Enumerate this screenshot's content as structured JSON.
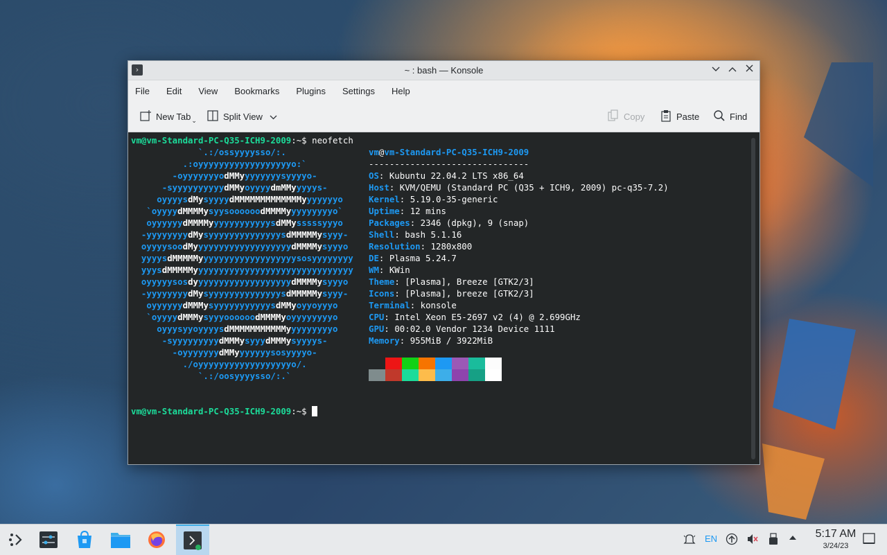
{
  "window": {
    "title": "~ : bash — Konsole"
  },
  "menubar": [
    "File",
    "Edit",
    "View",
    "Bookmarks",
    "Plugins",
    "Settings",
    "Help"
  ],
  "toolbar": {
    "new_tab": "New Tab",
    "split_view": "Split View",
    "copy": "Copy",
    "paste": "Paste",
    "find": "Find"
  },
  "terminal": {
    "prompt": "vm@vm-Standard-PC-Q35-ICH9-2009",
    "prompt_suffix": ":~$ ",
    "command": "neofetch",
    "header_user": "vm",
    "header_at": "@",
    "header_host": "vm-Standard-PC-Q35-ICH9-2009",
    "separator": "-------------------------------",
    "info": [
      {
        "key": "OS",
        "value": "Kubuntu 22.04.2 LTS x86_64"
      },
      {
        "key": "Host",
        "value": "KVM/QEMU (Standard PC (Q35 + ICH9, 2009) pc-q35-7.2)"
      },
      {
        "key": "Kernel",
        "value": "5.19.0-35-generic"
      },
      {
        "key": "Uptime",
        "value": "12 mins"
      },
      {
        "key": "Packages",
        "value": "2346 (dpkg), 9 (snap)"
      },
      {
        "key": "Shell",
        "value": "bash 5.1.16"
      },
      {
        "key": "Resolution",
        "value": "1280x800"
      },
      {
        "key": "DE",
        "value": "Plasma 5.24.7"
      },
      {
        "key": "WM",
        "value": "KWin"
      },
      {
        "key": "Theme",
        "value": "[Plasma], Breeze [GTK2/3]"
      },
      {
        "key": "Icons",
        "value": "[Plasma], breeze [GTK2/3]"
      },
      {
        "key": "Terminal",
        "value": "konsole"
      },
      {
        "key": "CPU",
        "value": "Intel Xeon E5-2697 v2 (4) @ 2.699GHz"
      },
      {
        "key": "GPU",
        "value": "00:02.0 Vendor 1234 Device 1111"
      },
      {
        "key": "Memory",
        "value": "955MiB / 3922MiB"
      }
    ],
    "logo": [
      [
        [
          "b",
          "             `.:/ossyyyysso/:."
        ]
      ],
      [
        [
          "b",
          "          .:oyyyyyyyyyyyyyyyyyyo:`"
        ]
      ],
      [
        [
          "b",
          "        -oyyyyyyyo"
        ],
        [
          "w",
          "dMMy"
        ],
        [
          "b",
          "yyyyyyysyyyyo-"
        ]
      ],
      [
        [
          "b",
          "      -syyyyyyyyyy"
        ],
        [
          "w",
          "dMMy"
        ],
        [
          "b",
          "oyyyy"
        ],
        [
          "w",
          "dmMMy"
        ],
        [
          "b",
          "yyyys-"
        ]
      ],
      [
        [
          "b",
          "     oyyyys"
        ],
        [
          "w",
          "dMy"
        ],
        [
          "b",
          "syyyy"
        ],
        [
          "w",
          "dMMMMMMMMMMMMMy"
        ],
        [
          "b",
          "yyyyyyo"
        ]
      ],
      [
        [
          "b",
          "   `oyyyy"
        ],
        [
          "w",
          "dMMMMy"
        ],
        [
          "b",
          "syysoooooo"
        ],
        [
          "w",
          "dMMMMy"
        ],
        [
          "b",
          "yyyyyyyyo`"
        ]
      ],
      [
        [
          "b",
          "   oyyyyyy"
        ],
        [
          "w",
          "dMMMMy"
        ],
        [
          "b",
          "yyyyyyyyyyys"
        ],
        [
          "w",
          "dMMy"
        ],
        [
          "b",
          "sssssyyyo"
        ]
      ],
      [
        [
          "b",
          "  -yyyyyyyy"
        ],
        [
          "w",
          "dMy"
        ],
        [
          "b",
          "syyyyyyyyyyyyyys"
        ],
        [
          "w",
          "dMMMMMy"
        ],
        [
          "b",
          "syyy-"
        ]
      ],
      [
        [
          "b",
          "  oyyyysoo"
        ],
        [
          "w",
          "dMy"
        ],
        [
          "b",
          "yyyyyyyyyyyyyyyyyy"
        ],
        [
          "w",
          "dMMMMy"
        ],
        [
          "b",
          "syyyo"
        ]
      ],
      [
        [
          "b",
          "  yyyys"
        ],
        [
          "w",
          "dMMMMMy"
        ],
        [
          "b",
          "yyyyyyyyyyyyyyyyyysosyyyyyyyy"
        ]
      ],
      [
        [
          "b",
          "  yyys"
        ],
        [
          "w",
          "dMMMMMy"
        ],
        [
          "b",
          "yyyyyyyyyyyyyyyyyyyyyyyyyyyyyy"
        ]
      ],
      [
        [
          "b",
          "  oyyyyysos"
        ],
        [
          "w",
          "dy"
        ],
        [
          "b",
          "yyyyyyyyyyyyyyyyyy"
        ],
        [
          "w",
          "dMMMMy"
        ],
        [
          "b",
          "syyyo"
        ]
      ],
      [
        [
          "b",
          "  -yyyyyyyy"
        ],
        [
          "w",
          "dMy"
        ],
        [
          "b",
          "syyyyyyyyyyyyyys"
        ],
        [
          "w",
          "dMMMMMy"
        ],
        [
          "b",
          "syyy-"
        ]
      ],
      [
        [
          "b",
          "   oyyyyyy"
        ],
        [
          "w",
          "dMMMy"
        ],
        [
          "b",
          "syyyyyyyyyyys"
        ],
        [
          "w",
          "dMMy"
        ],
        [
          "b",
          "oyyoyyyo"
        ]
      ],
      [
        [
          "b",
          "   `oyyyy"
        ],
        [
          "w",
          "dMMMy"
        ],
        [
          "b",
          "syyyoooooo"
        ],
        [
          "w",
          "dMMMMy"
        ],
        [
          "b",
          "oyyyyyyyyo"
        ]
      ],
      [
        [
          "b",
          "     oyyysyyoyyyys"
        ],
        [
          "w",
          "dMMMMMMMMMMMy"
        ],
        [
          "b",
          "yyyyyyyyo"
        ]
      ],
      [
        [
          "b",
          "      -syyyyyyyyy"
        ],
        [
          "w",
          "dMMMy"
        ],
        [
          "b",
          "syyy"
        ],
        [
          "w",
          "dMMMy"
        ],
        [
          "b",
          "syyyys-"
        ]
      ],
      [
        [
          "b",
          "        -oyyyyyyy"
        ],
        [
          "w",
          "dMMy"
        ],
        [
          "b",
          "yyyyyysosyyyyo-"
        ]
      ],
      [
        [
          "b",
          "          ./oyyyyyyyyyyyyyyyyyyo/."
        ]
      ],
      [
        [
          "b",
          "             `.:/oosyyyysso/:.`"
        ]
      ]
    ],
    "palette_top": [
      "#232627",
      "#ed1515",
      "#11d116",
      "#f67400",
      "#1d99f3",
      "#9b59b6",
      "#1abc9c",
      "#fcfcfc"
    ],
    "palette_bottom": [
      "#7f8c8d",
      "#c0392b",
      "#1cdc9a",
      "#fdbc4b",
      "#3daee9",
      "#8e44ad",
      "#16a085",
      "#ffffff"
    ]
  },
  "taskbar": {
    "tray_lang": "EN",
    "time": "5:17 AM",
    "date": "3/24/23",
    "icons": [
      "application-launcher-icon",
      "system-settings-icon",
      "discover-store-icon",
      "file-manager-icon",
      "firefox-icon",
      "konsole-icon"
    ]
  },
  "colors": {
    "terminal_bg": "#232627",
    "prompt_green": "#1cdc9a",
    "key_blue": "#1d99f3",
    "accent": "#3daee9"
  }
}
